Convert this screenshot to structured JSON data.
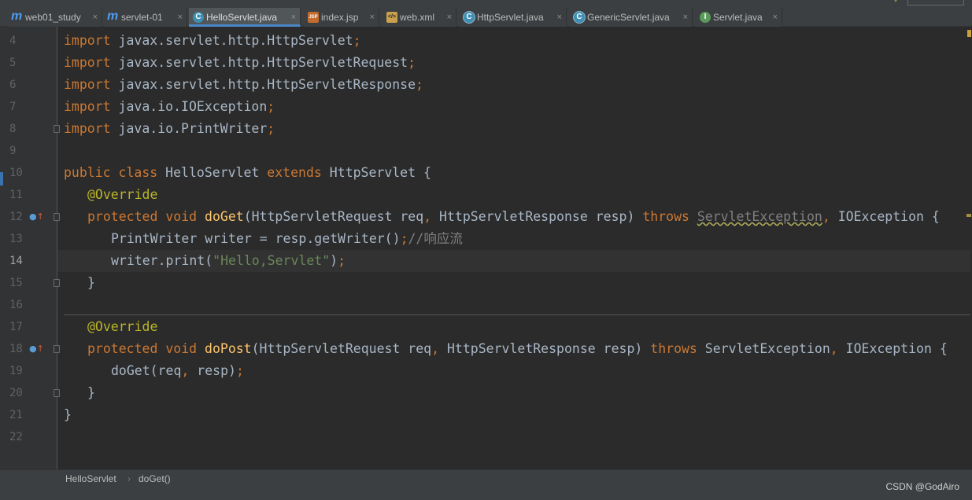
{
  "tabs": [
    {
      "icon": "maven-module-icon",
      "glyph": "m",
      "label": "web01_study",
      "close": "×",
      "active": false
    },
    {
      "icon": "maven-module-icon",
      "glyph": "m",
      "label": "servlet-01",
      "close": "×",
      "active": false
    },
    {
      "icon": "java-class-icon",
      "glyph": "C",
      "label": "HelloServlet.java",
      "close": "×",
      "active": true
    },
    {
      "icon": "jsp-file-icon",
      "glyph": "JSP",
      "label": "index.jsp",
      "close": "×",
      "active": false
    },
    {
      "icon": "xml-file-icon",
      "glyph": "</>",
      "label": "web.xml",
      "close": "×",
      "active": false
    },
    {
      "icon": "abstract-class-icon",
      "glyph": "C",
      "label": "HttpServlet.java",
      "close": "×",
      "active": false
    },
    {
      "icon": "abstract-class-icon",
      "glyph": "C",
      "label": "GenericServlet.java",
      "close": "×",
      "active": false
    },
    {
      "icon": "interface-icon",
      "glyph": "I",
      "label": "Servlet.java",
      "close": "×",
      "active": false
    }
  ],
  "editor": {
    "line_numbers": [
      "4",
      "5",
      "6",
      "7",
      "8",
      "9",
      "10",
      "11",
      "12",
      "13",
      "14",
      "15",
      "16",
      "17",
      "18",
      "19",
      "20",
      "21",
      "22"
    ],
    "current_line": "14",
    "lines": {
      "l4": {
        "kw": "import",
        "rest": " javax.servlet.http.HttpServlet",
        "semi": ";"
      },
      "l5": {
        "kw": "import",
        "rest": " javax.servlet.http.HttpServletRequest",
        "semi": ";"
      },
      "l6": {
        "kw": "import",
        "rest": " javax.servlet.http.HttpServletResponse",
        "semi": ";"
      },
      "l7": {
        "kw": "import",
        "rest": " java.io.IOException",
        "semi": ";"
      },
      "l8": {
        "kw": "import",
        "rest": " java.io.PrintWriter",
        "semi": ";"
      },
      "l10": {
        "kw1": "public class",
        "name": " HelloServlet ",
        "kw2": "extends",
        "rest": " HttpServlet {"
      },
      "l11": {
        "ann": "@Override"
      },
      "l12": {
        "kw1": "protected void",
        "fn": "doGet",
        "p1": "(HttpServletRequest req",
        "c1": ",",
        "p2": " HttpServletResponse resp) ",
        "kw2": "throws",
        "sp": " ",
        "warn": "ServletException",
        "c2": ",",
        "rest": " IOException {"
      },
      "l13": {
        "rest": "PrintWriter writer = resp.getWriter()",
        "semi": ";",
        "cmt": "//响应流"
      },
      "l14": {
        "pre": "writer.print(",
        "str": "\"Hello,Servlet\"",
        "post": ")",
        "semi": ";"
      },
      "l15": {
        "rest": "}"
      },
      "l17": {
        "ann": "@Override"
      },
      "l18": {
        "kw1": "protected void",
        "fn": "doPost",
        "p1": "(HttpServletRequest req",
        "c1": ",",
        "p2": " HttpServletResponse resp) ",
        "kw2": "throws",
        "p3": " ServletException",
        "c2": ",",
        "rest": " IOException {"
      },
      "l19": {
        "pre": "doGet(req",
        "c1": ",",
        "post": " resp)",
        "semi": ";"
      },
      "l20": {
        "rest": "}"
      },
      "l21": {
        "rest": "}"
      }
    }
  },
  "breadcrumb": {
    "class": "HelloServlet",
    "separator": "›",
    "method": "doGet()"
  },
  "watermark": "CSDN @GodAiro",
  "colors": {
    "keyword": "#cc7832",
    "annotation": "#bbb529",
    "method": "#ffc66d",
    "string": "#6a8759",
    "comment": "#808080",
    "text": "#a9b7c6",
    "background": "#2b2b2b"
  }
}
